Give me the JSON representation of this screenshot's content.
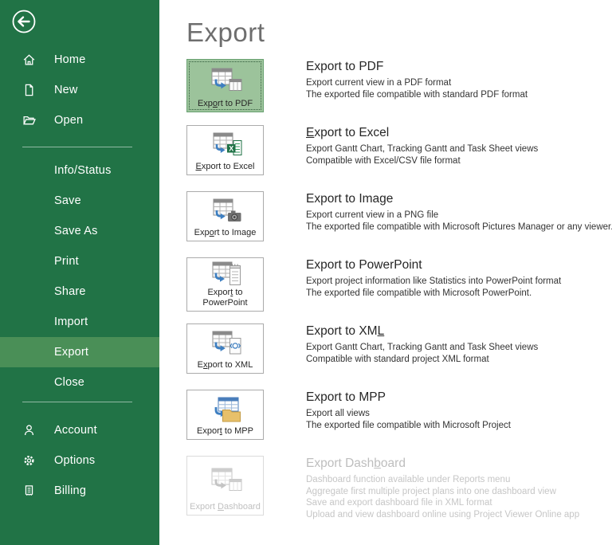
{
  "colors": {
    "sidebar-green": "#217346",
    "sidebar-highlight": "#4A8F57",
    "tile-selected-bg": "#9CC39B",
    "tile-selected-border": "#69A171",
    "tile-border": "#ABABAB",
    "arrow-blue": "#3E7FC1",
    "excel-green": "#1E7145",
    "mpp-folder-tan": "#E7C06A",
    "title-gray": "#6E6E6E",
    "disabled-gray": "#C0C0C0"
  },
  "sidebar": {
    "back_icon": "back-arrow-icon",
    "top_items": [
      {
        "label": "Home",
        "icon": "home-icon"
      },
      {
        "label": "New",
        "icon": "new-document-icon"
      },
      {
        "label": "Open",
        "icon": "open-folder-icon"
      }
    ],
    "middle_items": [
      {
        "label": "Info/Status"
      },
      {
        "label": "Save"
      },
      {
        "label": "Save As"
      },
      {
        "label": "Print"
      },
      {
        "label": "Share"
      },
      {
        "label": "Import"
      },
      {
        "label": "Export",
        "selected": true
      },
      {
        "label": "Close"
      }
    ],
    "bottom_items": [
      {
        "label": "Account",
        "icon": "account-person-icon"
      },
      {
        "label": "Options",
        "icon": "options-gear-icon"
      },
      {
        "label": "Billing",
        "icon": "billing-receipt-icon"
      }
    ]
  },
  "main": {
    "title": "Export",
    "options": [
      {
        "id": "export-to-pdf",
        "button_label": "Export to PDF",
        "button_accel": "o",
        "heading": "Export to PDF",
        "selected": true,
        "icon": "export-to-pdf-icon",
        "desc": [
          "Export current view in a PDF format",
          "The exported file compatible with standard PDF format"
        ]
      },
      {
        "id": "export-to-excel",
        "button_label": "Export to Excel",
        "button_accel": "E",
        "heading": "Export to Excel",
        "heading_accel": "E",
        "icon": "export-to-excel-icon",
        "desc": [
          "Export Gantt Chart, Tracking Gantt and Task Sheet views",
          "Compatible with Excel/CSV file format"
        ]
      },
      {
        "id": "export-to-image",
        "button_label": "Export to Image",
        "button_accel": "o",
        "heading": "Export to Image",
        "icon": "export-to-image-icon",
        "desc": [
          "Export current view in a PNG file",
          "The exported file compatible with Microsoft Pictures Manager or any viewer."
        ]
      },
      {
        "id": "export-to-powerpoint",
        "button_label": "Export to PowerPoint",
        "button_accel": "t",
        "heading": "Export to PowerPoint",
        "icon": "export-to-powerpoint-icon",
        "desc": [
          "Export project information like Statistics into PowerPoint format",
          "The exported file compatible with Microsoft PowerPoint."
        ]
      },
      {
        "id": "export-to-xml",
        "button_label": "Export to XML",
        "button_accel": "x",
        "heading": "Export to XML",
        "heading_accel": "L",
        "icon": "export-to-xml-icon",
        "desc": [
          "Export Gantt Chart, Tracking Gantt and Task Sheet views",
          "Compatible with standard project XML format"
        ]
      },
      {
        "id": "export-to-mpp",
        "button_label": "Export to MPP",
        "button_accel": "t",
        "heading": "Export to MPP",
        "icon": "export-to-mpp-icon",
        "desc": [
          "Export all views",
          "The exported file compatible with Microsoft Project"
        ]
      },
      {
        "id": "export-dashboard",
        "button_label": "Export Dashboard",
        "button_accel": "D",
        "heading": "Export Dashboard",
        "heading_accel": "b",
        "disabled": true,
        "icon": "export-dashboard-icon",
        "desc": [
          "Dashboard function available under Reports menu",
          "Aggregate first multiple project plans into one dashboard view",
          "Save and export dashboard file in XML format",
          "Upload and view dashboard online using Project Viewer Online app"
        ]
      }
    ]
  }
}
